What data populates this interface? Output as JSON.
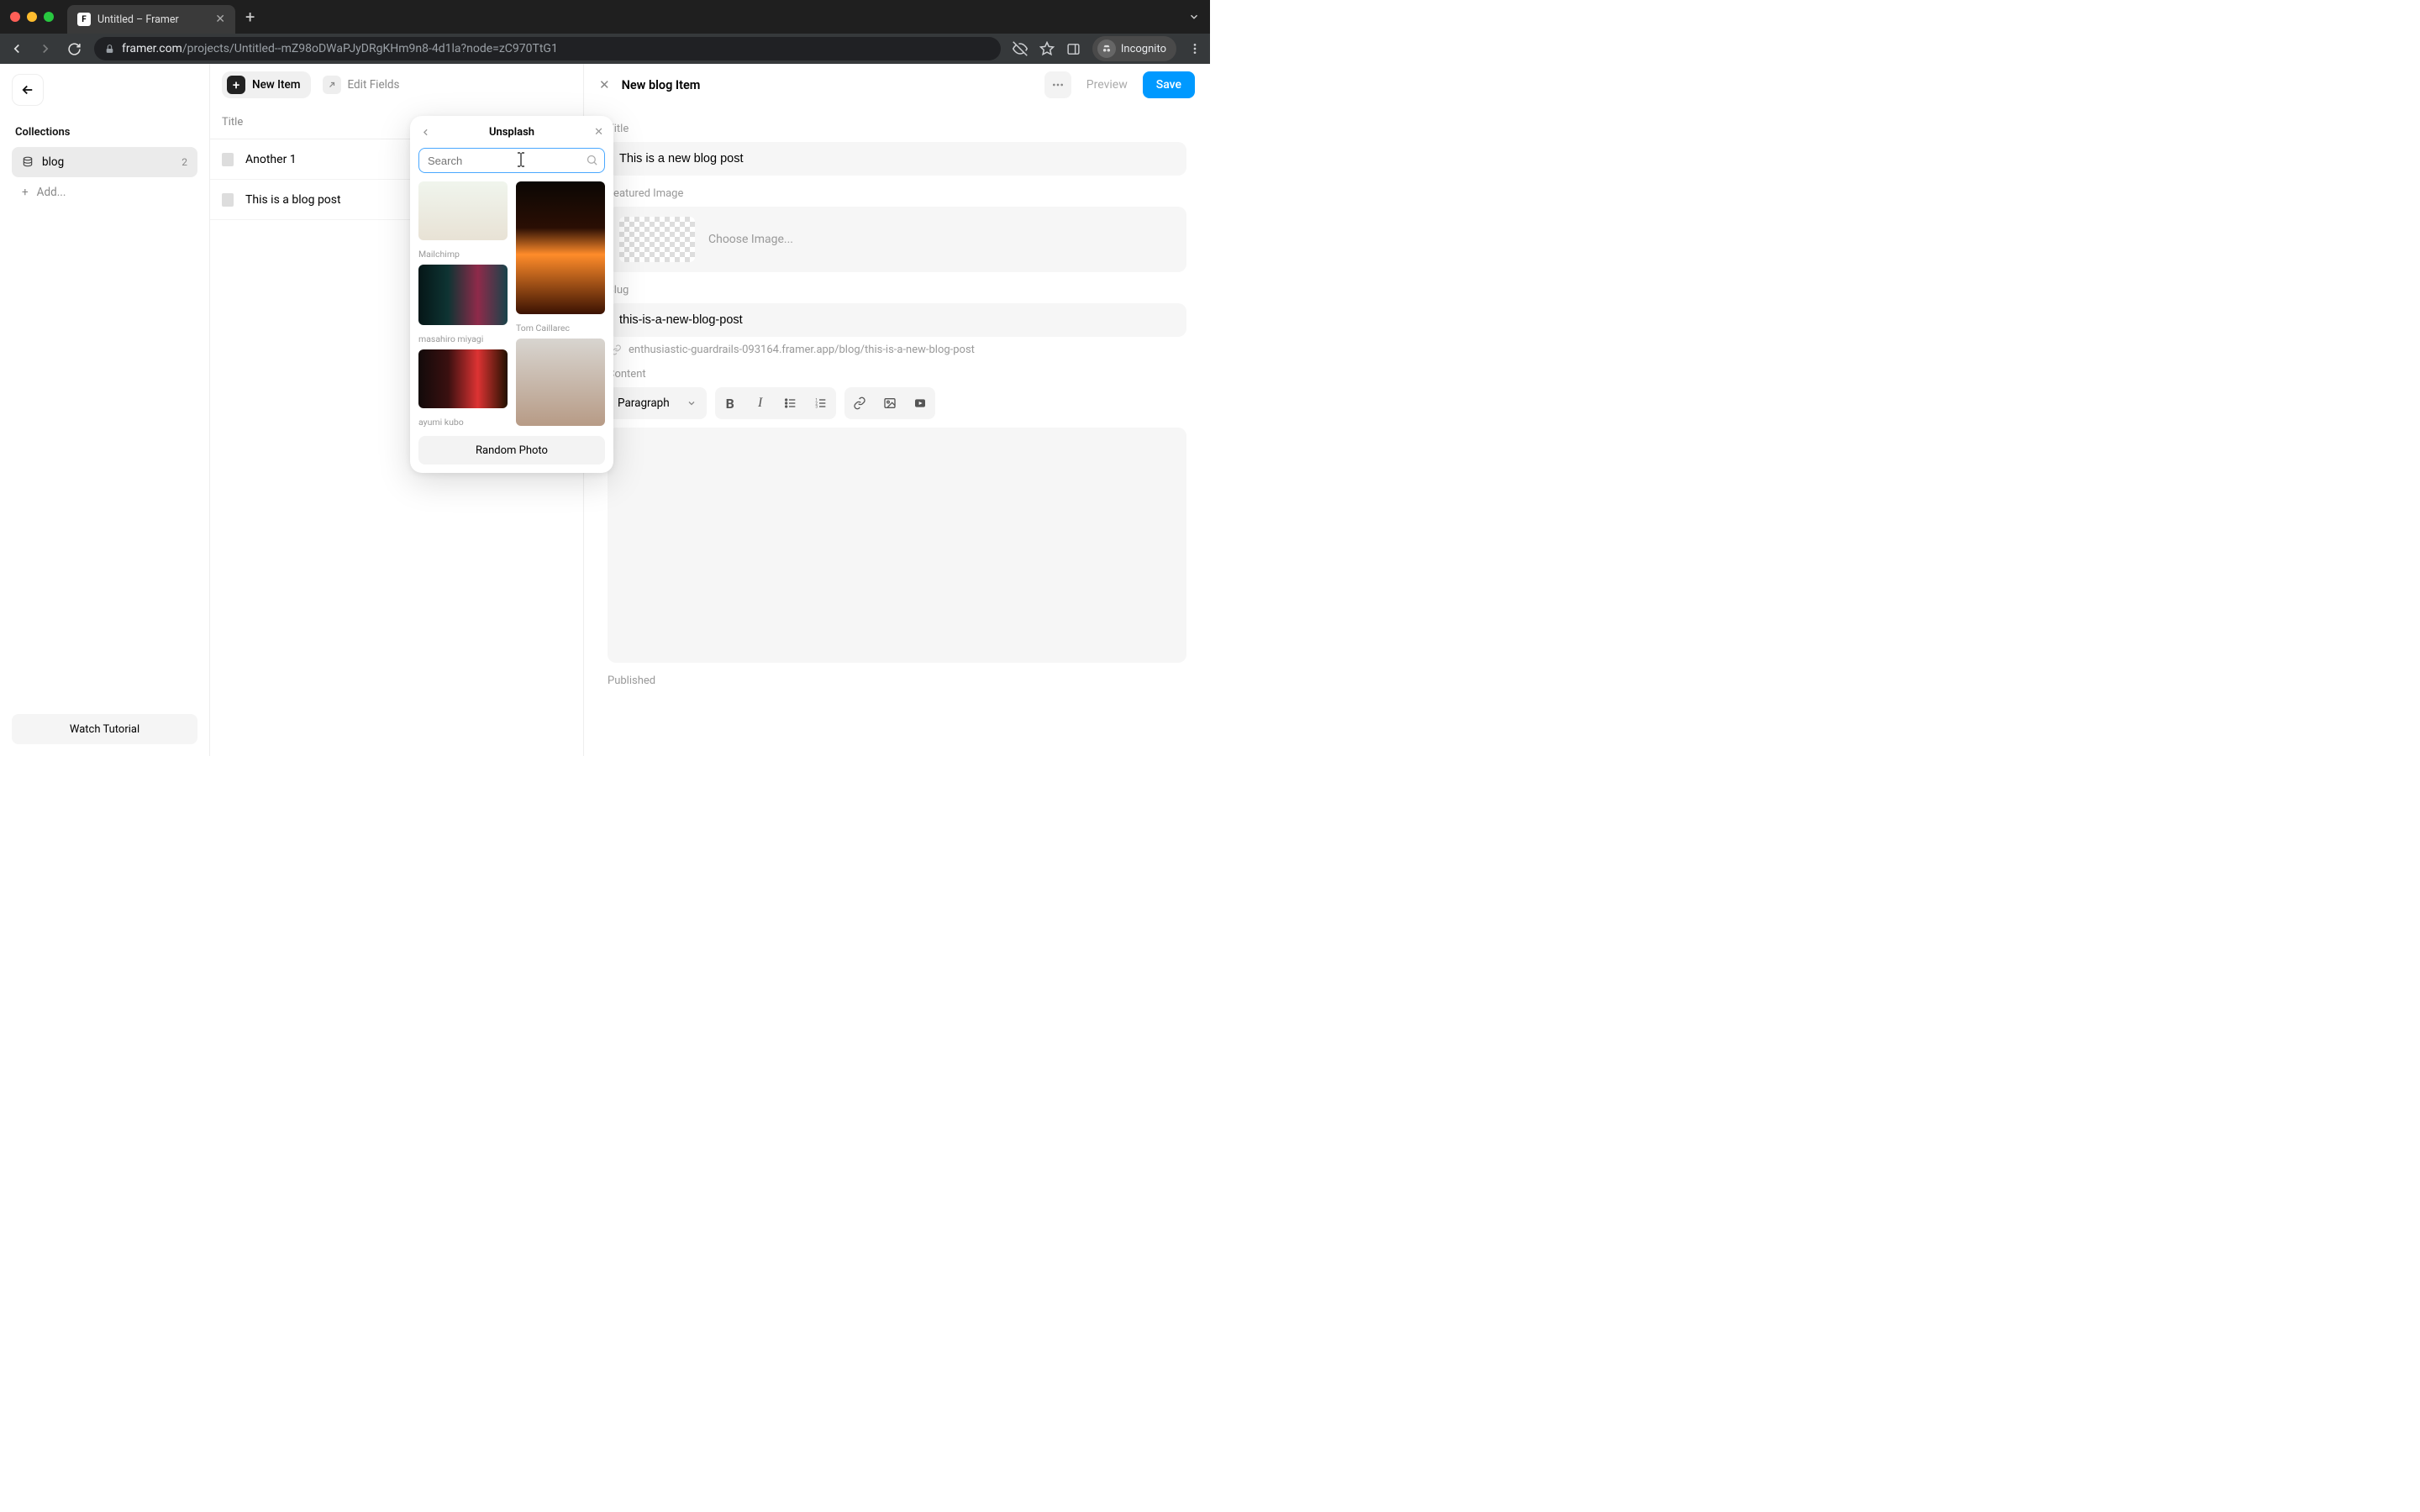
{
  "browser": {
    "tab_title": "Untitled – Framer",
    "url_domain": "framer.com",
    "url_path": "/projects/Untitled--mZ98oDWaPJyDRgKHm9n8-4d1la?node=zC970TtG1",
    "incognito_label": "Incognito"
  },
  "sidebar": {
    "section_label": "Collections",
    "items": [
      {
        "name": "blog",
        "count": "2"
      }
    ],
    "add_label": "Add...",
    "tutorial_label": "Watch Tutorial"
  },
  "list": {
    "new_item_label": "New Item",
    "edit_fields_label": "Edit Fields",
    "header_title": "Title",
    "rows": [
      {
        "title": "Another 1"
      },
      {
        "title": "This is a blog post"
      }
    ]
  },
  "detail": {
    "panel_title": "New blog Item",
    "preview_label": "Preview",
    "save_label": "Save",
    "fields": {
      "title_label": "Title",
      "title_value": "This is a new blog post",
      "featured_label": "Featured Image",
      "choose_image_label": "Choose Image...",
      "slug_label": "Slug",
      "slug_value": "this-is-a-new-blog-post",
      "slug_url": "enthusiastic-guardrails-093164.framer.app/blog/this-is-a-new-blog-post",
      "content_label": "Content",
      "paragraph_label": "Paragraph",
      "published_label": "Published"
    }
  },
  "popover": {
    "title": "Unsplash",
    "search_placeholder": "Search",
    "random_label": "Random Photo",
    "photos": [
      {
        "author": "Mailchimp"
      },
      {
        "author": "Tom Caillarec"
      },
      {
        "author": "masahiro miyagi"
      },
      {
        "author": "ayumi kubo"
      }
    ]
  }
}
